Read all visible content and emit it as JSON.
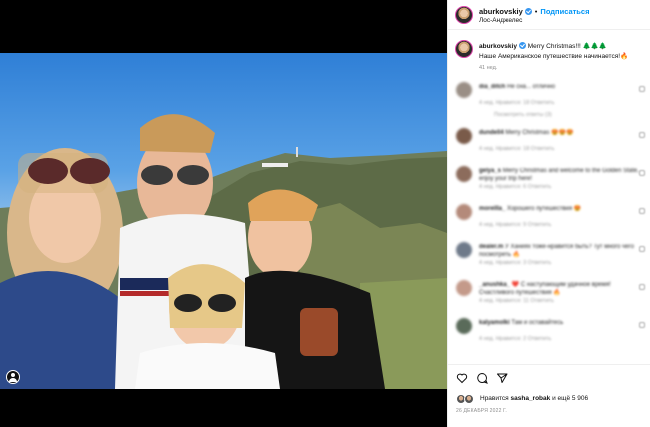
{
  "post": {
    "username": "aburkovskiy",
    "follow_label": "Подписаться",
    "location": "Лос-Анджелес",
    "caption_greeting": "Merry Christmas!!!",
    "caption_trees": "🌲🌲🌲",
    "caption_line2": "Наше Американское путешествие начинается!",
    "caption_fire": "🔥",
    "caption_time": "41 нед."
  },
  "comments": [
    {
      "user": "dia_ditch",
      "text": "Не сна... отлично",
      "meta": "4 нед.   Нравится: 18   Ответить",
      "replies": "Посмотреть ответы (3)",
      "avatar_color": "#9a8f86"
    },
    {
      "user": "dundell4",
      "text": "Merry Christmas 😍😍😍",
      "meta": "4 нед.   Нравится: 18   Ответить",
      "replies": "",
      "avatar_color": "#7a5b4a"
    },
    {
      "user": "gelya_s",
      "text": "Merry Christmas and welcome to the Golden State, enjoy your trip here!",
      "meta": "4 нед.   Нравится: 6   Ответить",
      "replies": "",
      "avatar_color": "#8c6c5c"
    },
    {
      "user": "moreilla_",
      "text": "Хорошего путешествия 😍",
      "meta": "4 нед.   Нравится: 9   Ответить",
      "replies": "",
      "avatar_color": "#b48a7a"
    },
    {
      "user": "dealer.m",
      "text": "У Ханиях тоже-нравится быть? Тут много чего посмотреть 🔥",
      "meta": "4 нед.   Нравится: 3   Ответить",
      "replies": "",
      "avatar_color": "#6f7a8a"
    },
    {
      "user": "_anushka_",
      "text": "❤️ С наступающим удачное время! Счастливого путешествия 🔥",
      "meta": "4 нед.   Нравится: 11   Ответить",
      "replies": "",
      "avatar_color": "#c49a8a"
    },
    {
      "user": "kalyamolki",
      "text": "Там и оставайтесь",
      "meta": "4 нед.   Нравится: 2   Ответить",
      "replies": "",
      "avatar_color": "#5a6b5a"
    }
  ],
  "actions": {
    "like_icon": "heart-icon",
    "comment_icon": "comment-icon",
    "share_icon": "share-icon",
    "likes_prefix": "Нравится",
    "likes_user": "sasha_robak",
    "likes_suffix": "и ещё 5 906",
    "date": "26 ДЕКАБРЯ 2022 Г."
  },
  "colors": {
    "accent": "#0095f6",
    "verified": "#3897f0",
    "muted": "#8e8e8e"
  }
}
